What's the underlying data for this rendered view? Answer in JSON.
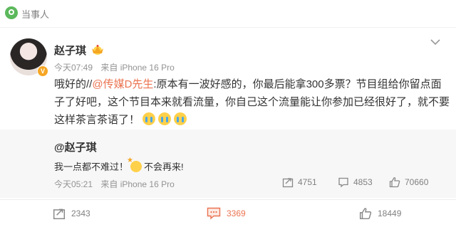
{
  "header": {
    "title": "当事人",
    "icon": "location-pin-icon"
  },
  "post": {
    "author": "赵子琪",
    "badge_icon": "member-crown-icon",
    "meta": {
      "time": "今天07:49",
      "source": "来自 iPhone 16 Pro"
    },
    "body": {
      "prefix": "哦好的//",
      "mention": "@传媒D先生",
      "text": ":原本有一波好感的，你最后能拿300多票？节目组给你留点面子了好吧，这个节目本来就看流量，你自己这个流量能让你参加已经很好了，就不要这样茶言茶语了！"
    }
  },
  "repost": {
    "author": "@赵子琪",
    "text_before": "我一点都不难过！",
    "text_after": "不会再来!",
    "meta": {
      "time": "今天05:21",
      "source": "来自 iPhone 16 Pro"
    },
    "actions": {
      "reposts": "4751",
      "comments": "4853",
      "likes": "70660"
    }
  },
  "footer": {
    "reposts": "2343",
    "comments": "3369",
    "likes": "18449",
    "accent_color": "#eb7350"
  }
}
